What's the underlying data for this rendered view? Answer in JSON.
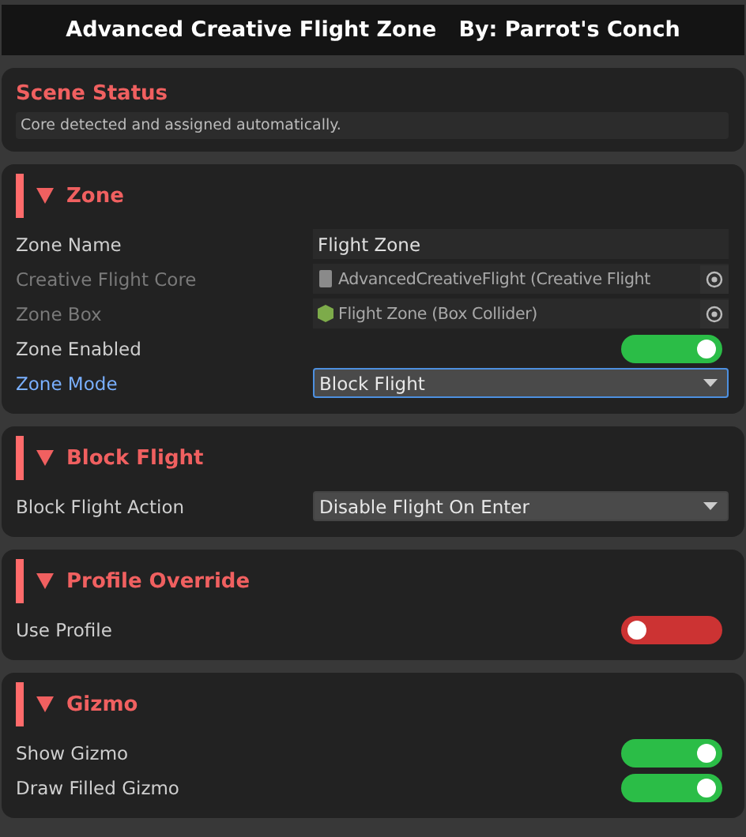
{
  "title": "Advanced Creative Flight Zone   By: Parrot's Conch",
  "status": {
    "title": "Scene Status",
    "message": "Core detected and assigned automatically."
  },
  "sections": [
    {
      "title": "Zone",
      "expanded": true,
      "rows": [
        {
          "kind": "text",
          "label": "Zone Name",
          "value": "Flight Zone",
          "disabled": false,
          "focused": false
        },
        {
          "kind": "script",
          "label": "Creative Flight Core",
          "value": "AdvancedCreativeFlight (Creative Flight",
          "disabled": true,
          "focused": false
        },
        {
          "kind": "collider",
          "label": "Zone Box",
          "value": "Flight Zone (Box Collider)",
          "disabled": true,
          "focused": false
        },
        {
          "kind": "toggle",
          "label": "Zone Enabled",
          "on": true,
          "disabled": false,
          "focused": false
        },
        {
          "kind": "dropdown",
          "label": "Zone Mode",
          "value": "Block Flight",
          "disabled": false,
          "focused": true
        }
      ]
    },
    {
      "title": "Block Flight",
      "expanded": true,
      "rows": [
        {
          "kind": "dropdown",
          "label": "Block Flight Action",
          "value": "Disable Flight On Enter",
          "disabled": false,
          "focused": false
        }
      ]
    },
    {
      "title": "Profile Override",
      "expanded": true,
      "rows": [
        {
          "kind": "toggle",
          "label": "Use Profile",
          "on": false,
          "disabled": false,
          "focused": false
        }
      ]
    },
    {
      "title": "Gizmo",
      "expanded": true,
      "rows": [
        {
          "kind": "toggle",
          "label": "Show Gizmo",
          "on": true,
          "disabled": false,
          "focused": false
        },
        {
          "kind": "toggle",
          "label": "Draw Filled Gizmo",
          "on": true,
          "disabled": false,
          "focused": false
        }
      ]
    }
  ]
}
